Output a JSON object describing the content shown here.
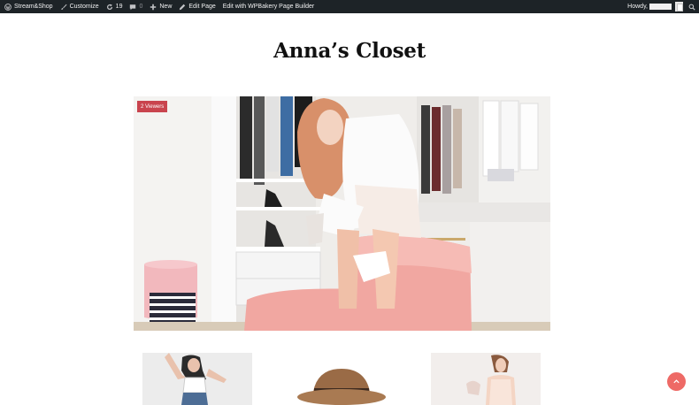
{
  "adminbar": {
    "site_name": "Stream&Shop",
    "customize": "Customize",
    "updates_count": "19",
    "comments_count": "0",
    "new_label": "New",
    "edit_page": "Edit Page",
    "wpbakery": "Edit with WPBakery Page Builder",
    "howdy": "Howdy,"
  },
  "page": {
    "title": "Anna’s Closet"
  },
  "hero": {
    "badge": "2 Viewers"
  },
  "colors": {
    "adminbar_bg": "#1d2327",
    "badge_bg": "#c9444e",
    "scroll_top_bg": "#ee6a66"
  },
  "icons": [
    "wordpress-icon",
    "brush-icon",
    "refresh-icon",
    "comment-icon",
    "plus-icon",
    "pencil-icon",
    "user-avatar-icon",
    "search-icon",
    "chevron-up-icon"
  ]
}
